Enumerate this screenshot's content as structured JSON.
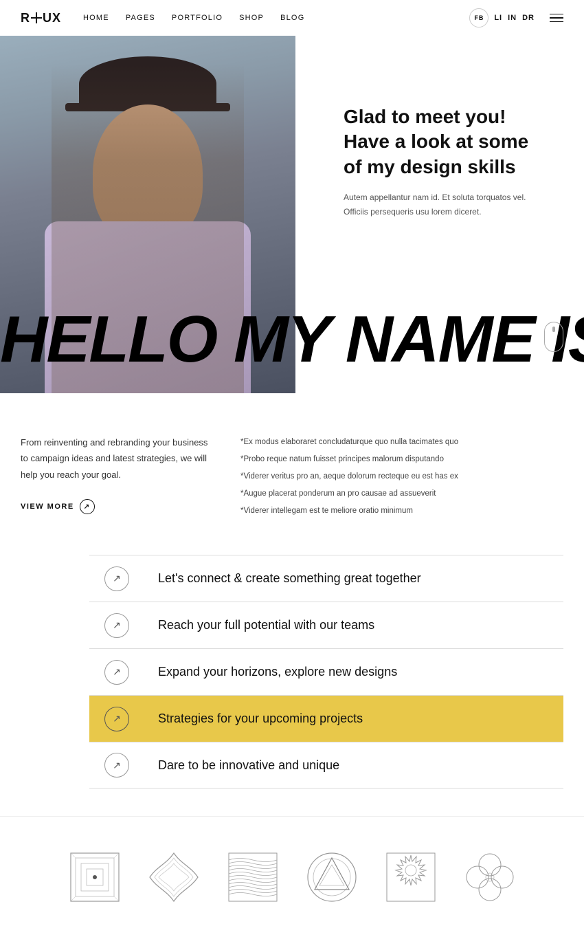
{
  "header": {
    "logo": "R+UX",
    "nav": [
      {
        "label": "HOME",
        "href": "#"
      },
      {
        "label": "PAGES",
        "href": "#"
      },
      {
        "label": "PORTFOLIO",
        "href": "#"
      },
      {
        "label": "SHOP",
        "href": "#"
      },
      {
        "label": "BLOG",
        "href": "#"
      }
    ],
    "social": [
      "FB",
      "LI",
      "IN",
      "DR"
    ]
  },
  "hero": {
    "heading": "Glad to meet you!\nHave a look at some\nof my design skills",
    "sub": "Autem appellantur nam id. Et soluta torquatos vel.\nOfficiis persequeris usu lorem diceret.",
    "big_text": "HELLO MY NAME IS"
  },
  "mid": {
    "left_text": "From reinventing and rebranding your business to campaign ideas and latest strategies, we will help you reach your goal.",
    "view_more": "VIEW MORE",
    "right_bullets": [
      "*Ex modus elaboraret concludaturque quo nulla tacimates quo",
      "*Probo reque natum fuisset principes malorum disputando",
      "*Viderer veritus pro an, aeque dolorum recteque eu est has ex",
      "*Augue placerat ponderum an pro causae ad assueverit",
      "*Viderer intellegam est te meliore oratio minimum"
    ]
  },
  "list": {
    "items": [
      {
        "text": "Let's connect & create something great together",
        "highlight": false
      },
      {
        "text": "Reach your full potential with our teams",
        "highlight": false
      },
      {
        "text": "Expand your horizons, explore new designs",
        "highlight": false
      },
      {
        "text": "Strategies for your upcoming projects",
        "highlight": true
      },
      {
        "text": "Dare to be innovative and unique",
        "highlight": false
      }
    ]
  },
  "icons": [
    {
      "name": "square-dot-icon"
    },
    {
      "name": "star-abstract-icon"
    },
    {
      "name": "waves-icon"
    },
    {
      "name": "triangle-circle-icon"
    },
    {
      "name": "gear-square-icon"
    },
    {
      "name": "flower-icon"
    }
  ]
}
